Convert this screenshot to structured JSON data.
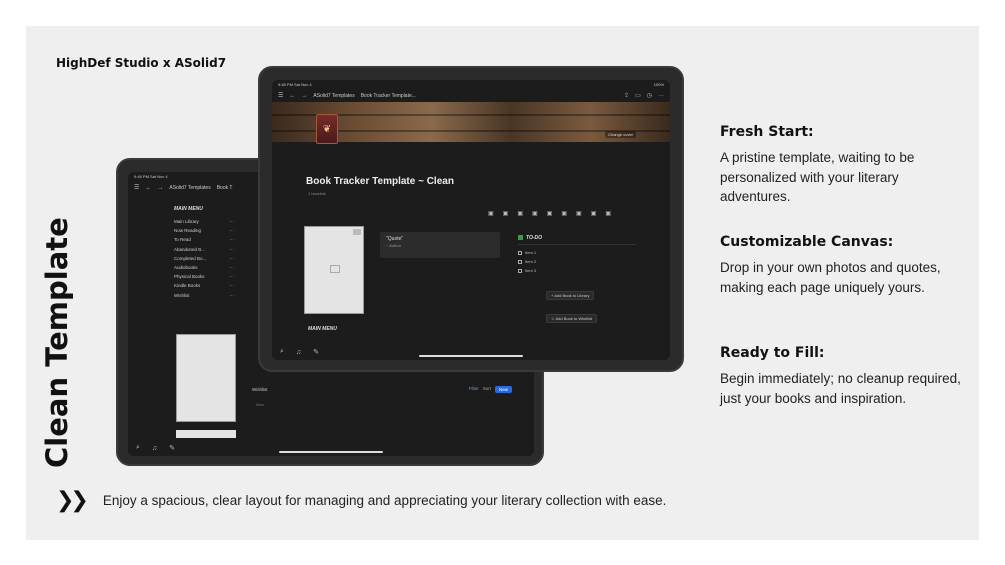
{
  "brand": "HighDef Studio x ASolid7",
  "vertical_title": "Clean Template",
  "front": {
    "status_time": "9:48 PM  Sat Nov 4",
    "status_right": "100%",
    "crumb_workspace": "ASolid7 Templates",
    "crumb_page": "Book Tracker Template...",
    "change_cover": "Change cover",
    "page_title": "Book Tracker Template ~ Clean",
    "backlink": "1 backlink",
    "quote": "\"Quote\"",
    "quote_author": "~ Author",
    "todo_title": "TO-DO",
    "todo_items": [
      "Item 1",
      "Item 2",
      "Item 3"
    ],
    "add_library": "Add Book to Library",
    "add_wishlist": "Add Book to Wishlist",
    "main_menu": "MAIN MENU"
  },
  "back": {
    "status_time": "9:48 PM  Sat Nov 4",
    "crumb_workspace": "ASolid7 Templates",
    "crumb_page": "Book T",
    "main_menu": "MAIN MENU",
    "menu_items": [
      "Main Library",
      "Now Reading",
      "To Read",
      "Abandoned B...",
      "Completed Bo...",
      "Audiobooks",
      "Physical Books",
      "Kindle Books",
      "Wishlist"
    ],
    "wishlist_tab": "Wishlist",
    "filter": "Filter",
    "sort": "Sort",
    "new": "New",
    "new_row": "New"
  },
  "features": [
    {
      "title": "Fresh Start:",
      "text": "A pristine template, waiting to be personalized with your literary adventures."
    },
    {
      "title": "Customizable Canvas:",
      "text": "Drop in your own photos and quotes, making each page uniquely yours."
    },
    {
      "title": "Ready to Fill:",
      "text": "Begin immediately; no cleanup required, just your books and inspiration."
    }
  ],
  "footer": "Enjoy a spacious, clear layout for managing and appreciating your literary collection with ease.",
  "footer_icon": "double-chevron-right-icon"
}
